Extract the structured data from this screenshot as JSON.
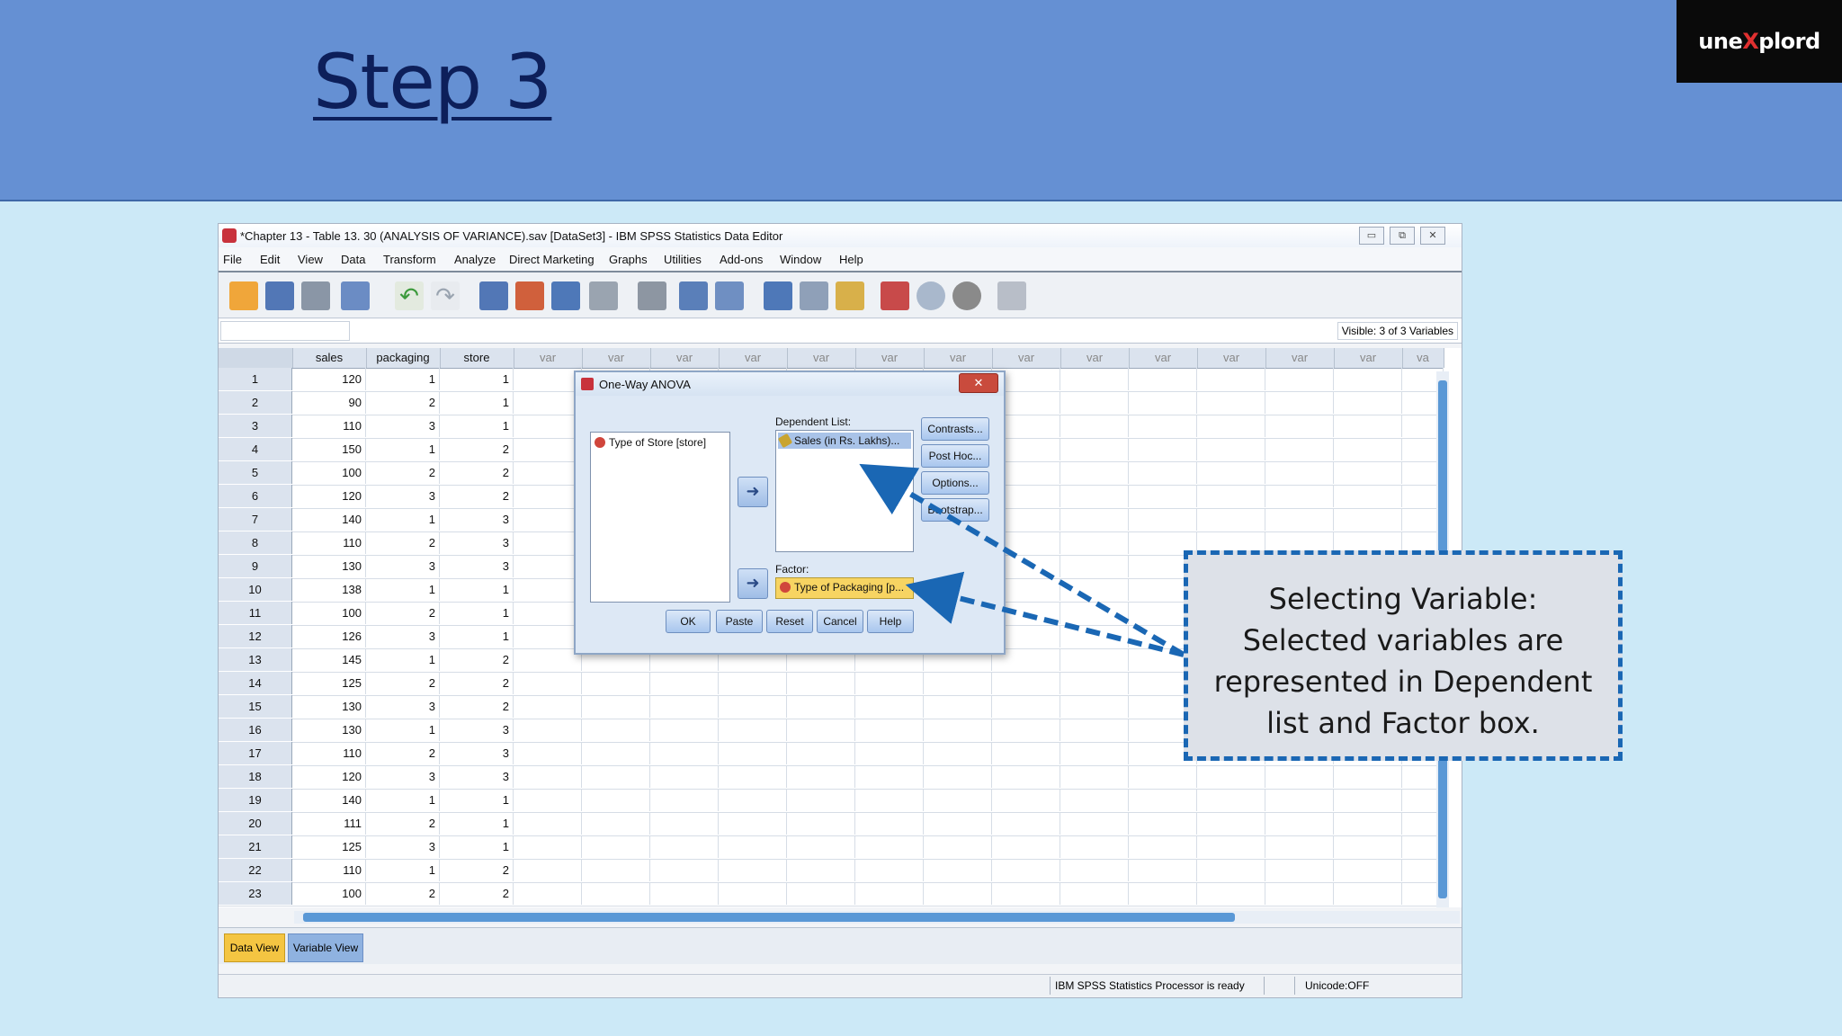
{
  "slide": {
    "title": "Step 3",
    "logo": {
      "pre": "une",
      "x": "X",
      "post": "plord"
    }
  },
  "window": {
    "title": "*Chapter 13 - Table 13. 30 (ANALYSIS OF VARIANCE).sav [DataSet3] - IBM SPSS Statistics Data Editor",
    "minimize": "▭",
    "restore": "⧉",
    "close": "✕"
  },
  "menu": [
    "File",
    "Edit",
    "View",
    "Data",
    "Transform",
    "Analyze",
    "Direct Marketing",
    "Graphs",
    "Utilities",
    "Add-ons",
    "Window",
    "Help"
  ],
  "toolbar": {
    "icons": [
      "open-icon",
      "save-icon",
      "print-icon",
      "recall-dialog-icon",
      "undo-icon",
      "redo-icon",
      "goto-case-icon",
      "goto-variable-icon",
      "variables-icon",
      "find-icon",
      "binoculars-icon",
      "insert-cases-icon",
      "insert-variable-icon",
      "split-file-icon",
      "weight-cases-icon",
      "select-cases-icon",
      "value-labels-icon",
      "use-sets-icon",
      "show-sets-icon",
      "spell-check-icon"
    ]
  },
  "varbar": {
    "visible": "Visible: 3 of 3 Variables"
  },
  "grid": {
    "columns": [
      "sales",
      "packaging",
      "store",
      "var",
      "var",
      "var",
      "var",
      "var",
      "var",
      "var",
      "var",
      "var",
      "var",
      "var",
      "var",
      "var",
      "va"
    ],
    "rows": [
      [
        "1",
        "120",
        "1",
        "1"
      ],
      [
        "2",
        "90",
        "2",
        "1"
      ],
      [
        "3",
        "110",
        "3",
        "1"
      ],
      [
        "4",
        "150",
        "1",
        "2"
      ],
      [
        "5",
        "100",
        "2",
        "2"
      ],
      [
        "6",
        "120",
        "3",
        "2"
      ],
      [
        "7",
        "140",
        "1",
        "3"
      ],
      [
        "8",
        "110",
        "2",
        "3"
      ],
      [
        "9",
        "130",
        "3",
        "3"
      ],
      [
        "10",
        "138",
        "1",
        "1"
      ],
      [
        "11",
        "100",
        "2",
        "1"
      ],
      [
        "12",
        "126",
        "3",
        "1"
      ],
      [
        "13",
        "145",
        "1",
        "2"
      ],
      [
        "14",
        "125",
        "2",
        "2"
      ],
      [
        "15",
        "130",
        "3",
        "2"
      ],
      [
        "16",
        "130",
        "1",
        "3"
      ],
      [
        "17",
        "110",
        "2",
        "3"
      ],
      [
        "18",
        "120",
        "3",
        "3"
      ],
      [
        "19",
        "140",
        "1",
        "1"
      ],
      [
        "20",
        "111",
        "2",
        "1"
      ],
      [
        "21",
        "125",
        "3",
        "1"
      ],
      [
        "22",
        "110",
        "1",
        "2"
      ],
      [
        "23",
        "100",
        "2",
        "2"
      ]
    ]
  },
  "tabs": {
    "data_view": "Data View",
    "variable_view": "Variable View"
  },
  "status": {
    "processor": "IBM SPSS Statistics Processor is ready",
    "unicode": "Unicode:OFF"
  },
  "dialog": {
    "title": "One-Way ANOVA",
    "close": "✕",
    "source_item": "Type of Store [store]",
    "dependent_label": "Dependent List:",
    "dependent_item": "Sales (in Rs. Lakhs)...",
    "factor_label": "Factor:",
    "factor_item": "Type of Packaging [p...",
    "arrow": "➜",
    "buttons": {
      "contrasts": "Contrasts...",
      "posthoc": "Post Hoc...",
      "options": "Options...",
      "bootstrap": "Bootstrap...",
      "ok": "OK",
      "paste": "Paste",
      "reset": "Reset",
      "cancel": "Cancel",
      "help": "Help"
    }
  },
  "callout": {
    "line1": "Selecting Variable:",
    "line2": "Selected variables are",
    "line3": "represented in Dependent",
    "line4": "list and Factor box."
  },
  "colors": {
    "header": "#6590d3",
    "title": "#0d1f5a",
    "background": "#cce9f7",
    "callout_border": "#1a67b4",
    "factor_highlight": "#f7d462",
    "active_tab": "#f4c542"
  }
}
